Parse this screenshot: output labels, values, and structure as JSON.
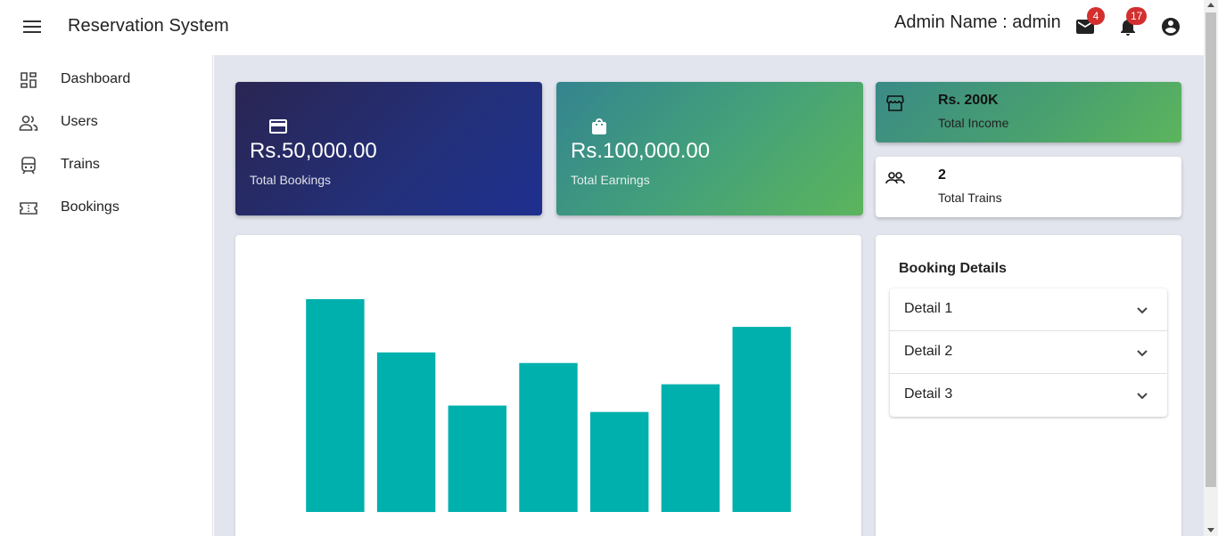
{
  "header": {
    "title": "Reservation System",
    "admin_label": "Admin Name : admin",
    "mail_badge": "4",
    "notification_badge": "17"
  },
  "sidebar": {
    "items": [
      {
        "label": "Dashboard",
        "icon": "dashboard-icon"
      },
      {
        "label": "Users",
        "icon": "users-icon"
      },
      {
        "label": "Trains",
        "icon": "train-icon"
      },
      {
        "label": "Bookings",
        "icon": "ticket-icon"
      }
    ]
  },
  "stats": {
    "bookings": {
      "value": "Rs.50,000.00",
      "caption": "Total Bookings",
      "icon": "credit-card-icon"
    },
    "earnings": {
      "value": "Rs.100,000.00",
      "caption": "Total Earnings",
      "icon": "shopping-bag-icon"
    },
    "income": {
      "value": "Rs. 200K",
      "caption": "Total Income",
      "icon": "store-icon"
    },
    "trains": {
      "value": "2",
      "caption": "Total Trains",
      "icon": "people-icon"
    }
  },
  "booking_details": {
    "title": "Booking Details",
    "items": [
      "Detail 1",
      "Detail 2",
      "Detail 3"
    ]
  },
  "colors": {
    "bar": "#00b0ad",
    "badge": "#d32f2f"
  },
  "chart_data": {
    "type": "bar",
    "categories": [
      "",
      "",
      "",
      "",
      "",
      "",
      ""
    ],
    "values": [
      100,
      75,
      50,
      70,
      47,
      60,
      87
    ],
    "ylim": [
      0,
      100
    ],
    "title": "",
    "xlabel": "",
    "ylabel": "",
    "grid": false,
    "legend": "none"
  }
}
